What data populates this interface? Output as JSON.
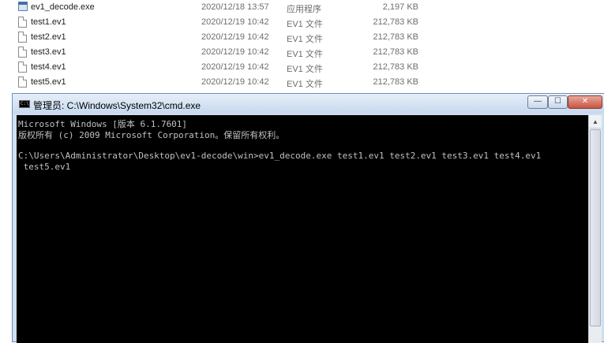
{
  "explorer": {
    "files": [
      {
        "name": "ev1_decode.exe",
        "date": "2020/12/18 13:57",
        "type": "应用程序",
        "size": "2,197 KB",
        "icon": "exe-icon"
      },
      {
        "name": "test1.ev1",
        "date": "2020/12/19 10:42",
        "type": "EV1 文件",
        "size": "212,783 KB",
        "icon": "file-icon"
      },
      {
        "name": "test2.ev1",
        "date": "2020/12/19 10:42",
        "type": "EV1 文件",
        "size": "212,783 KB",
        "icon": "file-icon"
      },
      {
        "name": "test3.ev1",
        "date": "2020/12/19 10:42",
        "type": "EV1 文件",
        "size": "212,783 KB",
        "icon": "file-icon"
      },
      {
        "name": "test4.ev1",
        "date": "2020/12/19 10:42",
        "type": "EV1 文件",
        "size": "212,783 KB",
        "icon": "file-icon"
      },
      {
        "name": "test5.ev1",
        "date": "2020/12/19 10:42",
        "type": "EV1 文件",
        "size": "212,783 KB",
        "icon": "file-icon"
      }
    ]
  },
  "cmd": {
    "title": "管理员: C:\\Windows\\System32\\cmd.exe",
    "icon_text": "C:\\",
    "buttons": {
      "minimize": "—",
      "maximize": "☐",
      "close": "✕"
    },
    "lines": [
      "Microsoft Windows [版本 6.1.7601]",
      "版权所有 (c) 2009 Microsoft Corporation。保留所有权利。",
      "",
      "C:\\Users\\Administrator\\Desktop\\ev1-decode\\win>ev1_decode.exe test1.ev1 test2.ev1 test3.ev1 test4.ev1",
      " test5.ev1"
    ],
    "colors": {
      "console_bg": "#000000",
      "console_text": "#c0c0c0"
    }
  }
}
